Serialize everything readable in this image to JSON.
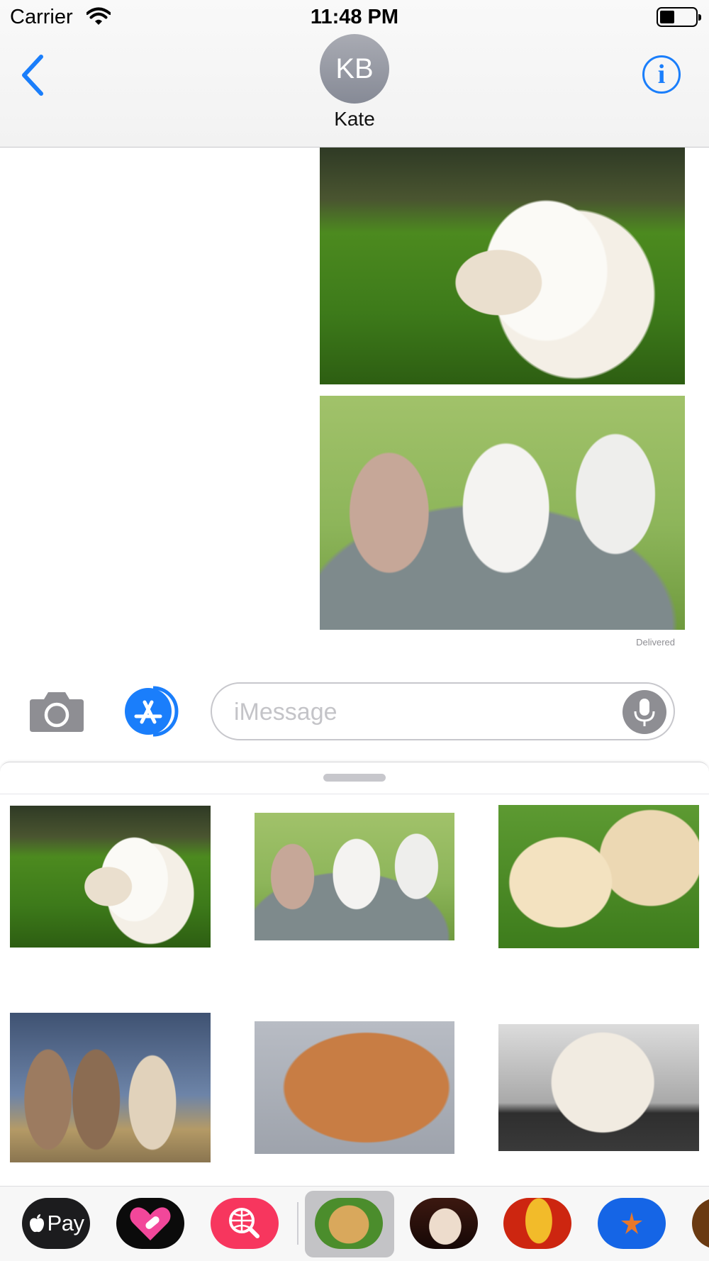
{
  "status_bar": {
    "carrier": "Carrier",
    "time": "11:48 PM"
  },
  "header": {
    "avatar_initials": "KB",
    "contact_name": "Kate",
    "info_glyph": "i"
  },
  "conversation": {
    "sent_photos": [
      "white-puppy-in-grass",
      "three-puppies-in-bucket"
    ],
    "delivered_label": "Delivered"
  },
  "compose": {
    "placeholder": "iMessage"
  },
  "drawer": {
    "gallery": [
      "white-puppy-in-grass",
      "three-puppies-in-bucket",
      "two-golden-puppies-in-grass",
      "three-husky-puppies",
      "sleeping-mastiff-puppy",
      "white-puppy-on-fence"
    ]
  },
  "app_strip": {
    "apple_pay_label": "Pay",
    "apps": [
      "apple-pay",
      "heart-stickers",
      "image-search",
      "puppy-stickers",
      "kitten-stickers",
      "flower-stickers",
      "starfish-stickers"
    ],
    "selected_app": "puppy-stickers"
  },
  "colors": {
    "ios_blue": "#1a7efb",
    "avatar_gray": "#8e8f99",
    "search_app_pink": "#f7365e"
  }
}
